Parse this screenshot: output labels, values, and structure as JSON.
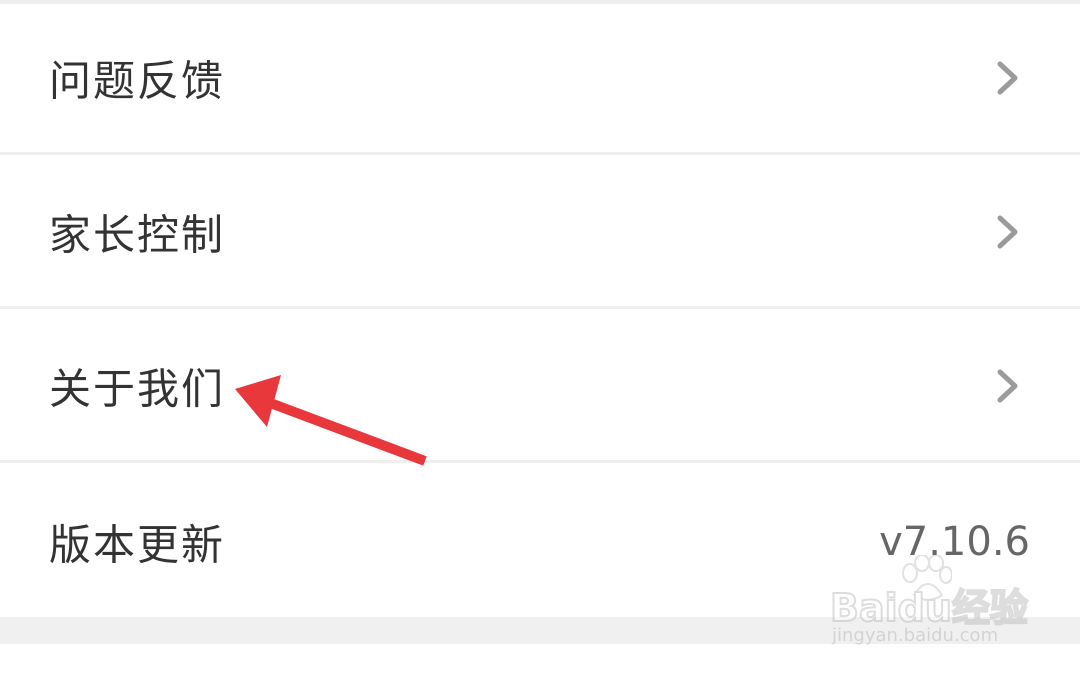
{
  "menu": {
    "items": [
      {
        "label": "问题反馈",
        "trailing": "chevron-right-icon"
      },
      {
        "label": "家长控制",
        "trailing": "chevron-right-icon"
      },
      {
        "label": "关于我们",
        "trailing": "chevron-right-icon"
      },
      {
        "label": "版本更新",
        "value": "v7.10.6"
      }
    ]
  },
  "annotation": {
    "color": "#e8383b",
    "icon": "red-arrow-icon"
  },
  "watermark": {
    "logo": "Baidu经验",
    "url": "jingyan.baidu.com"
  }
}
